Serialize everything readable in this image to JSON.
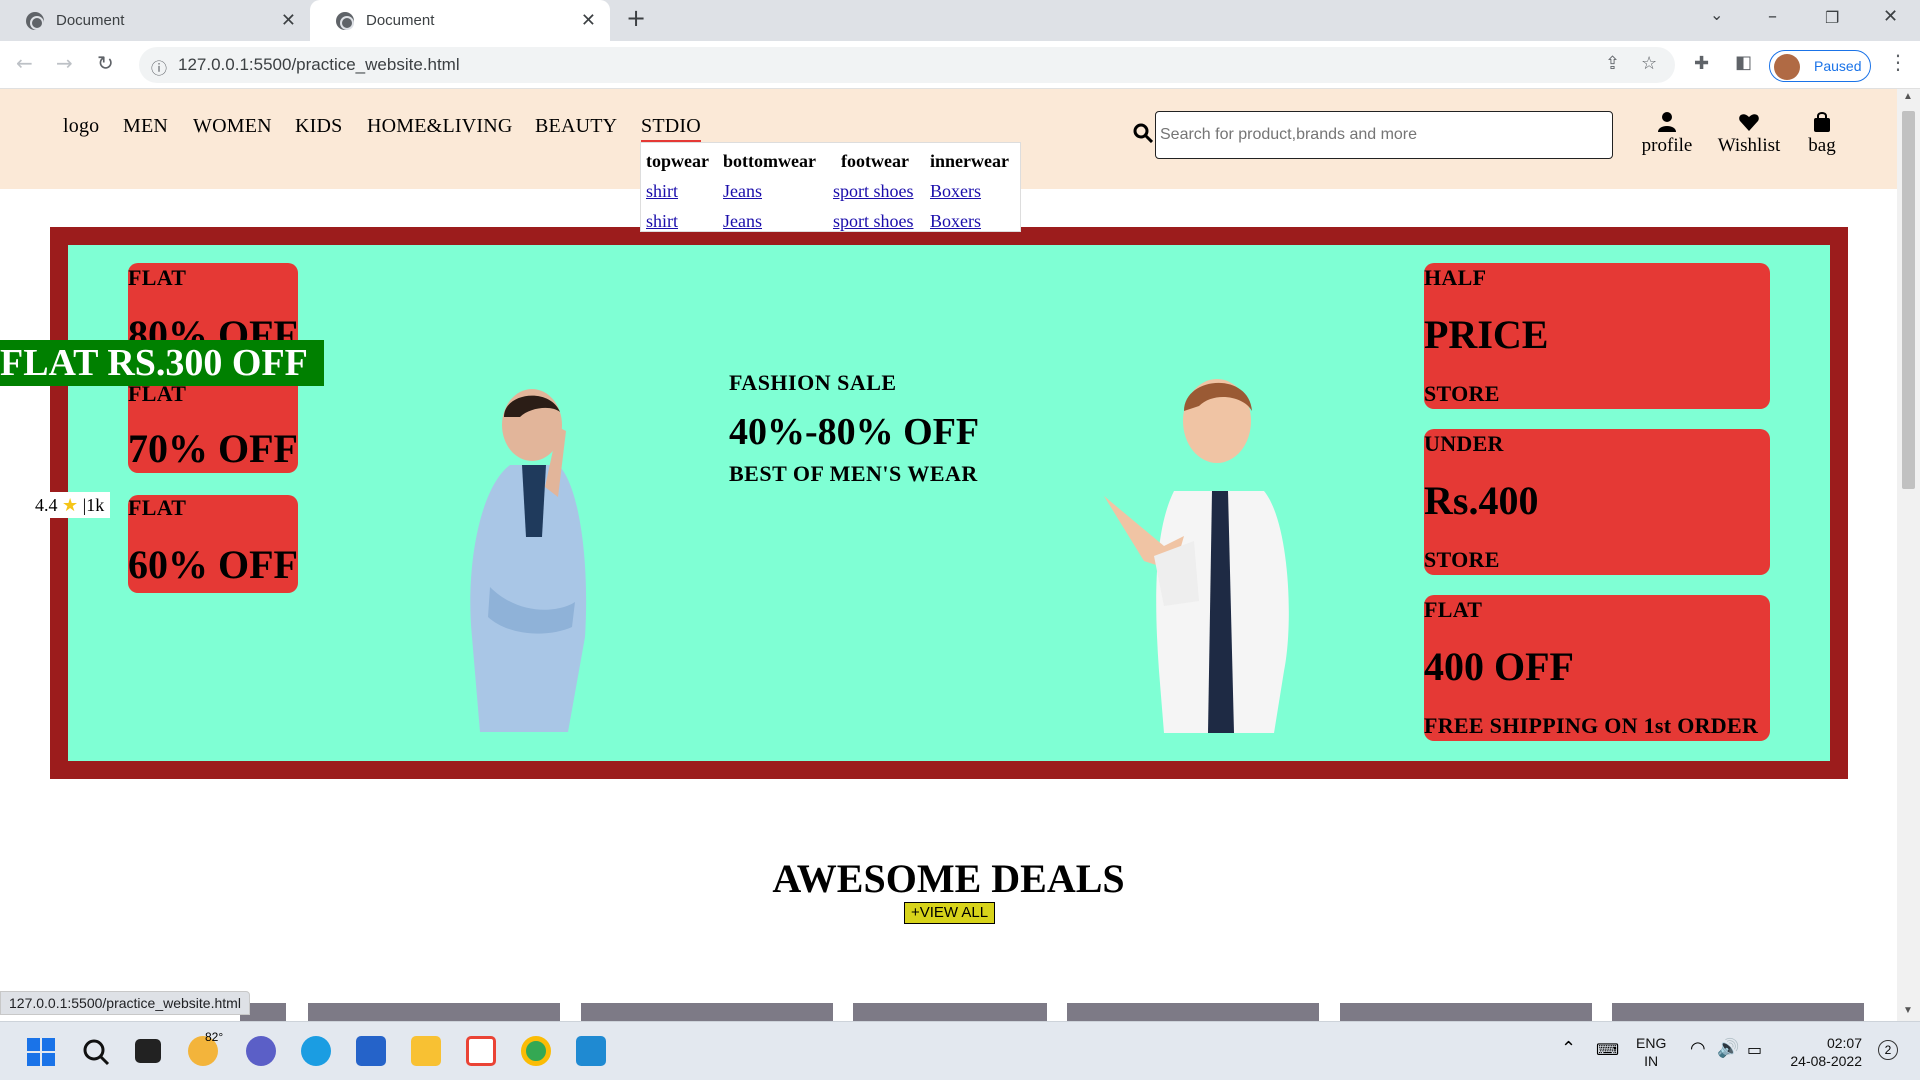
{
  "browser": {
    "tabs": [
      {
        "title": "Document"
      },
      {
        "title": "Document"
      }
    ],
    "url": "127.0.0.1:5500/practice_website.html",
    "profile_status": "Paused",
    "status_url": "127.0.0.1:5500/practice_website.html"
  },
  "site": {
    "logo": "logo",
    "nav": [
      "MEN",
      "WOMEN",
      "KIDS",
      "HOME&LIVING",
      "BEAUTY",
      "STDIO"
    ],
    "dropdown": {
      "headers": [
        "topwear",
        "bottomwear",
        "footwear",
        "innerwear"
      ],
      "rows": [
        [
          "shirt",
          "Jeans",
          "sport shoes",
          "Boxers"
        ],
        [
          "shirt",
          "Jeans",
          "sport shoes",
          "Boxers"
        ]
      ]
    },
    "search": {
      "placeholder": "Search for product,brands and more"
    },
    "header_actions": [
      "profile",
      "Wishlist",
      "bag"
    ]
  },
  "banner": {
    "left_boxes": [
      {
        "small": "FLAT",
        "big": "80% OFF"
      },
      {
        "small": "FLAT",
        "big": "70% OFF"
      },
      {
        "small": "FLAT",
        "big": "60% OFF"
      }
    ],
    "flat_overlay": "FLAT RS.300 OFF",
    "rating": {
      "value": "4.4",
      "count": "|1k"
    },
    "center": {
      "line1": "FASHION SALE",
      "line2": "40%-80% OFF",
      "line3": "BEST OF MEN'S WEAR"
    },
    "right_boxes": [
      {
        "top": "HALF",
        "big": "PRICE",
        "bottom": "STORE"
      },
      {
        "top": "UNDER",
        "big": "Rs.400",
        "bottom": "STORE"
      },
      {
        "top": "FLAT",
        "big": "400 OFF",
        "bottom": "FREE SHIPPING ON 1st ORDER"
      }
    ]
  },
  "deals": {
    "title": "AWESOME DEALS",
    "view_all": "+VIEW ALL"
  },
  "taskbar": {
    "weather": "82°",
    "lang": "ENG",
    "region": "IN",
    "time": "02:07",
    "date": "24-08-2022",
    "notifications": "2"
  },
  "colors": {
    "header_bg": "#fbe9d7",
    "banner_border": "#9c1c1c",
    "banner_bg": "#7fffd4",
    "offer_box": "#e53935",
    "overlay_green": "#008000"
  }
}
